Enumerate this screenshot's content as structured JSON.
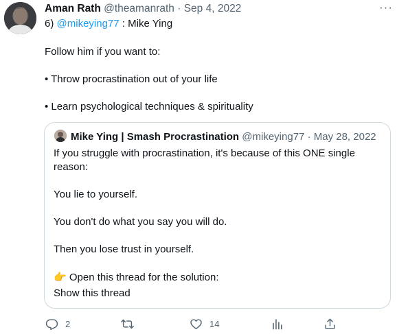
{
  "tweet": {
    "author_name": "Aman Rath",
    "handle": "@theamanrath",
    "separator": "·",
    "date": "Sep 4, 2022",
    "more_label": "···",
    "line1_prefix": "6)",
    "line1_mention": "@mikeying77",
    "line1_suffix": ": Mike Ying",
    "line2": "Follow him if you want to:",
    "bullet1": "• Throw procrastination out of your life",
    "bullet2": "• Learn psychological techniques & spirituality"
  },
  "quote": {
    "author_name": "Mike Ying | Smash Procrastination",
    "handle": "@mikeying77",
    "separator": "·",
    "date": "May 28, 2022",
    "line1": "If you struggle with procrastination, it's because of this ONE single",
    "line2": "reason:",
    "line3": "You lie to yourself.",
    "line4": "You don't do what you say you will do.",
    "line5": "Then you lose trust in yourself.",
    "line6_emoji": "👉",
    "line6_text": "Open this thread for the solution:",
    "show_thread": "Show this thread"
  },
  "actions": {
    "reply_count": "2",
    "retweet_count": "",
    "like_count": "14",
    "icons": [
      "reply-icon",
      "retweet-icon",
      "like-icon",
      "analytics-icon",
      "share-icon"
    ]
  },
  "colors": {
    "link": "#1d9bf0",
    "muted": "#536471",
    "text": "#0f1419",
    "border": "#cfd9de"
  }
}
